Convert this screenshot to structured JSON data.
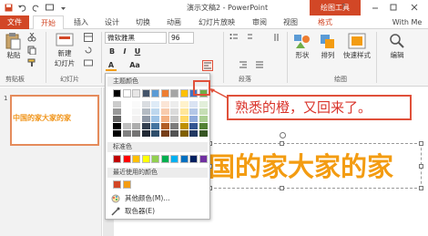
{
  "window": {
    "title": "演示文稿2 - PowerPoint",
    "contextual_header": "绘图工具",
    "help": "?"
  },
  "tabs": [
    "文件",
    "开始",
    "插入",
    "设计",
    "切换",
    "动画",
    "幻灯片放映",
    "审阅",
    "视图",
    "格式",
    "With Me"
  ],
  "ribbon": {
    "clipboard": {
      "paste": "粘贴",
      "label": "剪贴板"
    },
    "slides": {
      "new_slide_line1": "新建",
      "new_slide_line2": "幻灯片",
      "label": "幻灯片"
    },
    "font": {
      "name": "微软雅黑",
      "size": "96",
      "bold": "B",
      "italic": "I",
      "underline": "U",
      "font_color": "A",
      "font_size_menu": "Aa"
    },
    "paragraph": {
      "label": "段落"
    },
    "drawing": {
      "shapes": "形状",
      "arrange": "排列",
      "quick_styles": "快速样式",
      "label": "绘图"
    },
    "editing": {
      "label": "编辑"
    }
  },
  "thumbnail": {
    "number": "1",
    "text": "中国的家大家的家"
  },
  "slide": {
    "text": "国的家大家的家"
  },
  "color_dropdown": {
    "theme_colors_label": "主题颜色",
    "standard_colors_label": "标准色",
    "recent_colors_label": "最近使用的颜色",
    "more_colors": "其他颜色(M)...",
    "eyedropper": "取色器(E)",
    "theme_colors_top": [
      "#000000",
      "#ffffff",
      "#e7e6e6",
      "#44546a",
      "#5b9bd5",
      "#ed7d31",
      "#a5a5a5",
      "#ffc000",
      "#4472c4",
      "#70ad47"
    ],
    "standard_colors": [
      "#c00000",
      "#ff0000",
      "#ffc000",
      "#ffff00",
      "#92d050",
      "#00b050",
      "#00b0f0",
      "#0070c0",
      "#002060",
      "#7030a0"
    ],
    "recent_colors": [
      "#d24726",
      "#f39c12"
    ]
  },
  "callout": {
    "text": "熟悉的橙，又回来了。"
  },
  "colors": {
    "accent": "#d24726",
    "slide_text": "#f39c12",
    "callout_border": "#e0503a"
  }
}
